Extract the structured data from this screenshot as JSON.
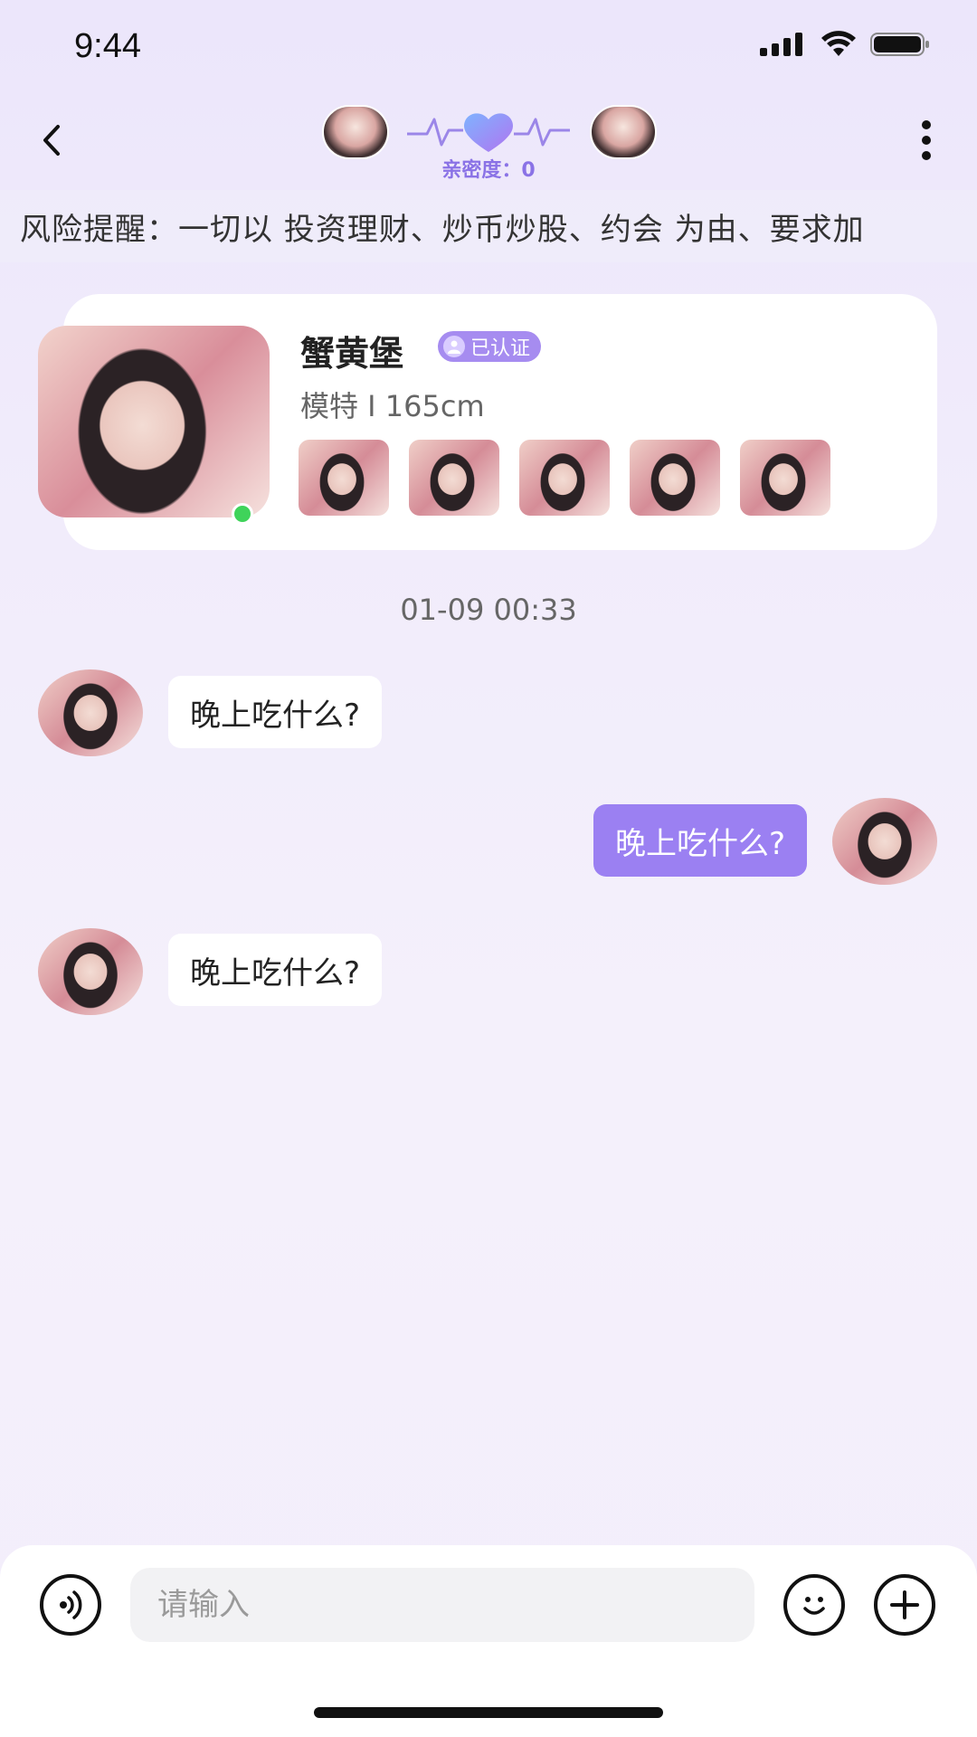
{
  "status_bar": {
    "time": "9:44"
  },
  "header": {
    "intimacy": "亲密度：0",
    "icons": {
      "back": "chevron-left-icon",
      "more": "more-vertical-icon",
      "heart": "heart-icon"
    }
  },
  "risk_notice": "风险提醒：一切以 投资理财、炒币炒股、约会 为由、要求加",
  "profile": {
    "name": "蟹黄堡",
    "verified_label": "已认证",
    "meta": "模特 I 165cm",
    "online": true,
    "thumbnail_count": 5
  },
  "chat": {
    "timestamp": "01-09 00:33",
    "messages": [
      {
        "direction": "incoming",
        "text": "晚上吃什么?"
      },
      {
        "direction": "outgoing",
        "text": "晚上吃什么?"
      },
      {
        "direction": "incoming",
        "text": "晚上吃什么?"
      }
    ]
  },
  "input_bar": {
    "placeholder": "请输入",
    "icons": {
      "voice": "voice-icon",
      "emoji": "emoji-icon",
      "add": "plus-icon"
    }
  },
  "colors": {
    "accent": "#9b80f2",
    "intimacy": "#8a72e6",
    "online": "#3fd35a"
  }
}
